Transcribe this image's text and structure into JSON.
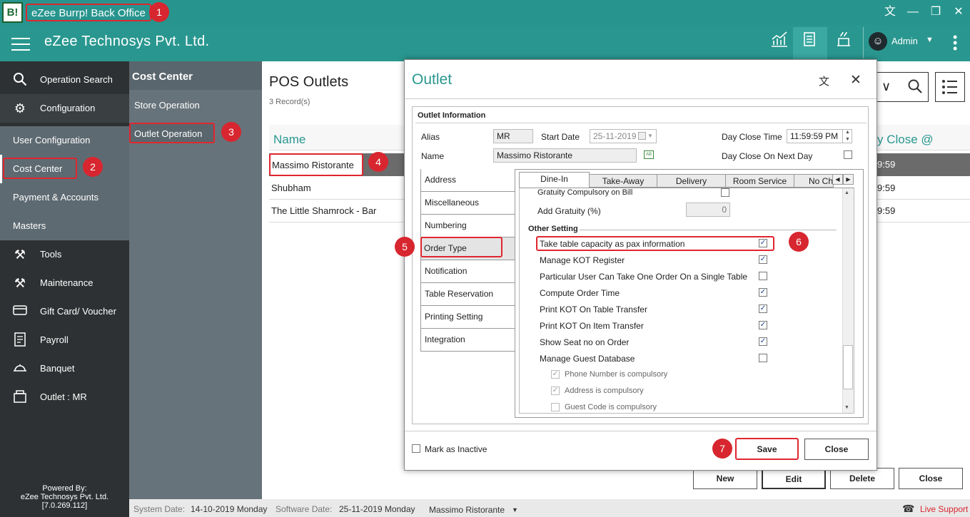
{
  "app": {
    "logo_text": "B!",
    "title": "eZee Burrp! Back Office",
    "company": "eZee Technosys Pvt. Ltd.",
    "user": "Admin"
  },
  "sidebar": {
    "items": [
      {
        "label": "Operation Search",
        "icon": "search-icon"
      },
      {
        "label": "Configuration",
        "icon": "gear-icon"
      },
      {
        "label": "User Configuration"
      },
      {
        "label": "Cost Center"
      },
      {
        "label": "Payment & Accounts"
      },
      {
        "label": "Masters"
      },
      {
        "label": "Tools",
        "icon": "tools-icon"
      },
      {
        "label": "Maintenance",
        "icon": "maintenance-icon"
      },
      {
        "label": "Gift Card/ Voucher",
        "icon": "gift-card-icon"
      },
      {
        "label": "Payroll",
        "icon": "payroll-icon"
      },
      {
        "label": "Banquet",
        "icon": "banquet-icon"
      },
      {
        "label": "Outlet : MR",
        "icon": "outlet-icon"
      }
    ],
    "powered_by": "Powered By:",
    "powered_company": "eZee Technosys Pvt. Ltd.",
    "version": "[7.0.269.112]"
  },
  "submenu": {
    "title": "Cost Center",
    "items": [
      "Store Operation",
      "Outlet Operation"
    ]
  },
  "main": {
    "title": "POS Outlets",
    "record_count": "3 Record(s)",
    "col_name": "Name",
    "col_close": "y Close @",
    "rows": [
      {
        "name": "Massimo Ristorante",
        "time": "9:59"
      },
      {
        "name": "Shubham",
        "time": "9:59"
      },
      {
        "name": "The Little Shamrock - Bar",
        "time": "9:59"
      }
    ],
    "buttons": {
      "new": "New",
      "edit": "Edit",
      "delete": "Delete",
      "close": "Close"
    }
  },
  "status": {
    "system_date_label": "System Date:",
    "system_date": "14-10-2019 Monday",
    "software_date_label": "Software Date:",
    "software_date": "25-11-2019 Monday",
    "outlet": "Massimo Ristorante",
    "live_support": "Live Support"
  },
  "dialog": {
    "title": "Outlet",
    "section": "Outlet Information",
    "alias_label": "Alias",
    "alias": "MR",
    "start_date_label": "Start Date",
    "start_date": "25-11-2019",
    "day_close_time_label": "Day Close Time",
    "day_close_time": "11:59:59 PM",
    "name_label": "Name",
    "name": "Massimo Ristorante",
    "day_close_next_label": "Day Close On Next Day",
    "left_tabs": [
      "Address",
      "Miscellaneous",
      "Numbering",
      "Order Type",
      "Notification",
      "Table Reservation",
      "Printing Setting",
      "Integration"
    ],
    "top_tabs": [
      "Dine-In",
      "Take-Away",
      "Delivery",
      "Room Service",
      "No Ch"
    ],
    "gratuity_compulsory": "Gratuity Compulsory on Bill",
    "add_gratuity_label": "Add Gratuity (%)",
    "add_gratuity": "0",
    "other_setting": "Other Setting",
    "settings": [
      {
        "label": "Take table capacity as pax information",
        "checked": true
      },
      {
        "label": "Manage KOT Register",
        "checked": true
      },
      {
        "label": "Particular User Can Take One Order On a Single Table",
        "checked": false
      },
      {
        "label": "Compute Order Time",
        "checked": true
      },
      {
        "label": "Print KOT On Table Transfer",
        "checked": true
      },
      {
        "label": "Print KOT On Item Transfer",
        "checked": true
      },
      {
        "label": "Show Seat no on Order",
        "checked": true
      },
      {
        "label": "Manage Guest Database",
        "checked": false
      }
    ],
    "sub_settings": [
      {
        "label": "Phone Number is compulsory",
        "checked": true
      },
      {
        "label": "Address is compulsory",
        "checked": true
      },
      {
        "label": "Guest Code is compulsory",
        "checked": false
      }
    ],
    "mark_inactive": "Mark as Inactive",
    "save": "Save",
    "close": "Close"
  },
  "annotations": [
    "1",
    "2",
    "3",
    "4",
    "5",
    "6",
    "7"
  ],
  "colors": {
    "teal": "#27958e",
    "sidebar": "#2e3133",
    "submenu": "#67737a",
    "accent_red": "#d7262f"
  }
}
